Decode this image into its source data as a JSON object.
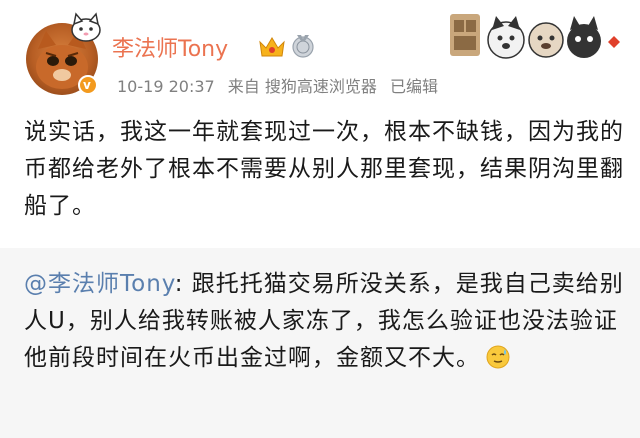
{
  "header": {
    "username": "李法师Tony",
    "time": "10-19 20:37",
    "source": "来自 搜狗高速浏览器",
    "edited": "已编辑"
  },
  "post": {
    "text": "说实话，我这一年就套现过一次，根本不缺钱，因为我的币都给老外了根本不需要从别人那里套现，结果阴沟里翻船了。"
  },
  "repost": {
    "mention": "@李法师Tony",
    "text": ": 跟托托猫交易所没关系，是我自己卖给别人U，别人给我转账被人家冻了，我怎么验证也没法验证他前段时间在火币出金过啊，金额又不大。",
    "emoji": "sweat-smile-emoji"
  },
  "colors": {
    "username": "#eb7350",
    "mention": "#5a7fae",
    "meta": "#808080",
    "repost_bg": "#f6f6f6"
  }
}
